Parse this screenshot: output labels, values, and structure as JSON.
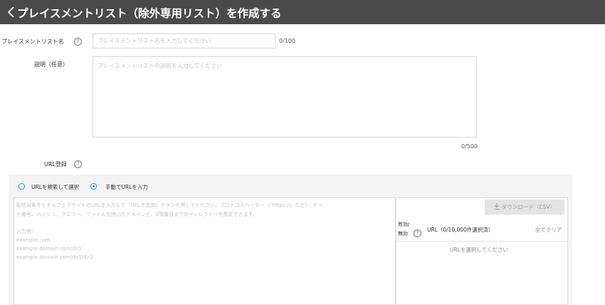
{
  "header": {
    "title": "プレイスメントリスト（除外専用リスト）を作成する"
  },
  "form": {
    "name_label": "プレイスメントリスト名",
    "name_placeholder": "プレイスメントリスト名を入力してください",
    "name_counter": "0/100",
    "desc_label": "説明（任意）",
    "desc_placeholder": "プレイスメントリストの説明を入力してください",
    "desc_counter": "0/500",
    "url_label": "URL登録"
  },
  "url_mode": {
    "options": [
      {
        "label": "URLを検索して選択",
        "selected": false
      },
      {
        "label": "手動でURLを入力",
        "selected": true
      }
    ]
  },
  "manual_input": {
    "hint_line1": "配信対象外とするウェブサイトのURLを入力して「URLを追加」ボタンを押してください。プロトコルヘッダー（「https://」など）、ポー",
    "hint_line2": "ト番号、ハッシュ、クエリー、ファイルを除いたドメインと、2階層目までのディレクトリを指定できます。",
    "example_title": "入力例：",
    "examples": [
      "example.com",
      "example.domain.com/dir1",
      "example.domain.com/dir1/dir2"
    ]
  },
  "selected_panel": {
    "download_label": "ダウンロード（CSV）",
    "col_status_line1": "有効/",
    "col_status_line2": "無効",
    "col_url": "URL（0/10,000件選択済）",
    "clear_all": "全てクリア",
    "empty_message": "URLを選択してください"
  },
  "colors": {
    "header_bg": "#4a4a4a",
    "radio_accent": "#2f7fd6"
  }
}
